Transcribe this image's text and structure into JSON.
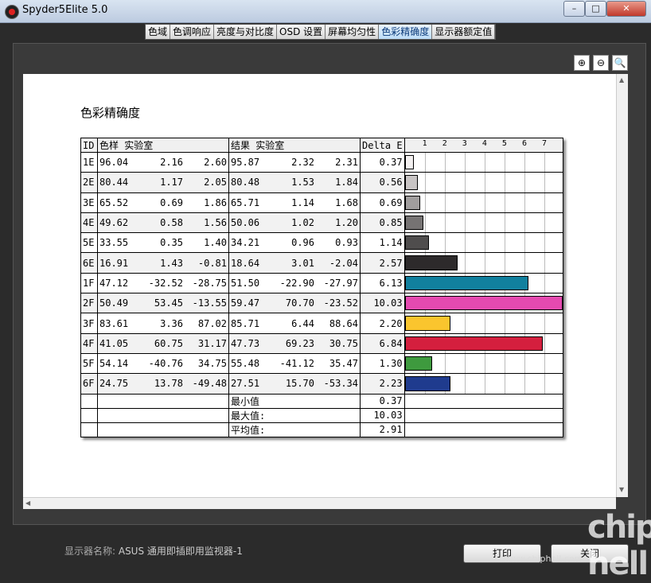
{
  "window": {
    "title": "Spyder5Elite 5.0",
    "minimize": "–",
    "maximize": "□",
    "close": "✕"
  },
  "tabs": [
    "色域",
    "色调响应",
    "亮度与对比度",
    "OSD 设置",
    "屏幕均匀性",
    "色彩精确度",
    "显示器额定值"
  ],
  "active_tab": "色彩精确度",
  "zoom": {
    "in": "⊕",
    "out": "⊖",
    "fit": "🔍"
  },
  "report": {
    "title": "色彩精确度",
    "headers": {
      "id": "ID",
      "sample": "色样 实验室",
      "result": "结果 实验室",
      "delta": "Delta E"
    },
    "ticks": [
      "1",
      "2",
      "3",
      "4",
      "5",
      "6",
      "7"
    ],
    "rows": [
      {
        "id": "1E",
        "s": [
          "96.04",
          "2.16",
          "2.60"
        ],
        "r": [
          "95.87",
          "2.32",
          "2.31"
        ],
        "de": "0.37",
        "color": "#f3f0f0"
      },
      {
        "id": "2E",
        "s": [
          "80.44",
          "1.17",
          "2.05"
        ],
        "r": [
          "80.48",
          "1.53",
          "1.84"
        ],
        "de": "0.56",
        "color": "#c8c4c4"
      },
      {
        "id": "3E",
        "s": [
          "65.52",
          "0.69",
          "1.86"
        ],
        "r": [
          "65.71",
          "1.14",
          "1.68"
        ],
        "de": "0.69",
        "color": "#a09d9d"
      },
      {
        "id": "4E",
        "s": [
          "49.62",
          "0.58",
          "1.56"
        ],
        "r": [
          "50.06",
          "1.02",
          "1.20"
        ],
        "de": "0.85",
        "color": "#767373"
      },
      {
        "id": "5E",
        "s": [
          "33.55",
          "0.35",
          "1.40"
        ],
        "r": [
          "34.21",
          "0.96",
          "0.93"
        ],
        "de": "1.14",
        "color": "#4f4d4d"
      },
      {
        "id": "6E",
        "s": [
          "16.91",
          "1.43",
          "-0.81"
        ],
        "r": [
          "18.64",
          "3.01",
          "-2.04"
        ],
        "de": "2.57",
        "color": "#2d2a2b"
      },
      {
        "id": "1F",
        "s": [
          "47.12",
          "-32.52",
          "-28.75"
        ],
        "r": [
          "51.50",
          "-22.90",
          "-27.97"
        ],
        "de": "6.13",
        "color": "#11809e"
      },
      {
        "id": "2F",
        "s": [
          "50.49",
          "53.45",
          "-13.55"
        ],
        "r": [
          "59.47",
          "70.70",
          "-23.52"
        ],
        "de": "10.03",
        "color": "#e54ab0"
      },
      {
        "id": "3F",
        "s": [
          "83.61",
          "3.36",
          "87.02"
        ],
        "r": [
          "85.71",
          "6.44",
          "88.64"
        ],
        "de": "2.20",
        "color": "#fac52e"
      },
      {
        "id": "4F",
        "s": [
          "41.05",
          "60.75",
          "31.17"
        ],
        "r": [
          "47.73",
          "69.23",
          "30.75"
        ],
        "de": "6.84",
        "color": "#d41f3e"
      },
      {
        "id": "5F",
        "s": [
          "54.14",
          "-40.76",
          "34.75"
        ],
        "r": [
          "55.48",
          "-41.12",
          "35.47"
        ],
        "de": "1.30",
        "color": "#3e9a3e"
      },
      {
        "id": "6F",
        "s": [
          "24.75",
          "13.78",
          "-49.48"
        ],
        "r": [
          "27.51",
          "15.70",
          "-53.34"
        ],
        "de": "2.23",
        "color": "#1f3b8e"
      }
    ],
    "stats": [
      {
        "label": "最小值",
        "value": "0.37"
      },
      {
        "label": "最大值:",
        "value": "10.03"
      },
      {
        "label": "平均值:",
        "value": "2.91"
      }
    ],
    "scale_max": 7.9
  },
  "footer": {
    "display_prefix": "显示器名称: ",
    "display_name": "ASUS 通用即插即用监视器-1",
    "print": "打印",
    "close": "关闭"
  },
  "watermark": {
    "url": "www.chiphell.com",
    "logo": "chip hell"
  }
}
